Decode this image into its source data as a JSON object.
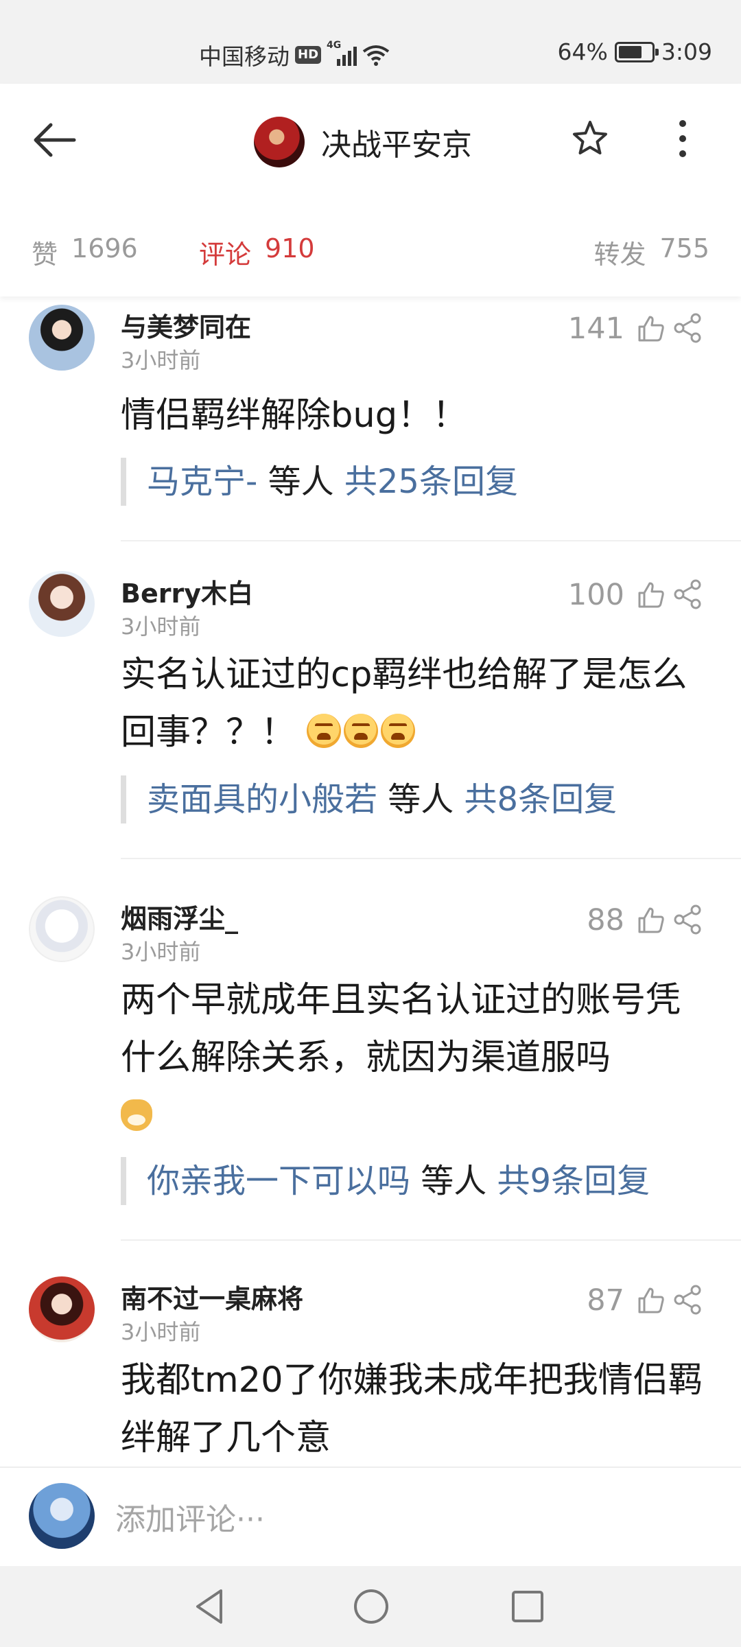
{
  "status_bar": {
    "carrier": "中国移动",
    "hd": "HD",
    "network": "4G",
    "battery": "64%",
    "battery_level": 0.64,
    "time": "3:09"
  },
  "header": {
    "title": "决战平安京",
    "tabs": [
      {
        "label": "赞",
        "count": "1696"
      },
      {
        "label": "评论",
        "count": "910"
      },
      {
        "label": "转发",
        "count": "755"
      }
    ]
  },
  "comments": [
    {
      "name": "与美梦同在",
      "time": "3小时前",
      "likes": "141",
      "text": "情侣羁绊解除bug！！",
      "reply_user": "马克宁-",
      "reply_mid": " 等人 ",
      "reply_total": "共25条回复"
    },
    {
      "name": "Berry木白",
      "time": "3小时前",
      "likes": "100",
      "text": "实名认证过的cp羁绊也给解了是怎么回事？？！",
      "reply_user": "卖面具的小般若",
      "reply_mid": " 等人 ",
      "reply_total": "共8条回复"
    },
    {
      "name": "烟雨浮尘_",
      "time": "3小时前",
      "likes": "88",
      "text": "两个早就成年且实名认证过的账号凭什么解除关系，就因为渠道服吗",
      "reply_user": "你亲我一下可以吗",
      "reply_mid": " 等人 ",
      "reply_total": "共9条回复"
    },
    {
      "name": "南不过一桌麻将",
      "time": "3小时前",
      "likes": "87",
      "text": "我都tm20了你嫌我未成年把我情侣羁绊解了几个意"
    }
  ],
  "input": {
    "placeholder": "添加评论···"
  },
  "colors": {
    "accent_red": "#d43b3b",
    "link_blue": "#4a6f9e",
    "muted_gray": "#9b9b9b"
  },
  "icons": [
    "back-arrow-icon",
    "star-icon",
    "more-vert-icon",
    "thumb-up-icon",
    "share-icon",
    "nav-back-icon",
    "nav-home-icon",
    "nav-recents-icon"
  ]
}
